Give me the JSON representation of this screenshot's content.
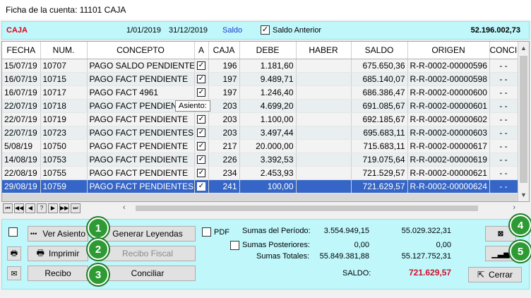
{
  "window": {
    "title": "Ficha de la cuenta: 11101 CAJA"
  },
  "header": {
    "account": "CAJA",
    "date_from": "1/01/2019",
    "date_to": "31/12/2019",
    "saldo_link": "Saldo",
    "saldo_anterior_label": "Saldo  Anterior",
    "saldo_anterior_checked": true,
    "total": "52.196.002,73"
  },
  "grid": {
    "columns": [
      "FECHA",
      "NUM.",
      "CONCEPTO",
      "A",
      "CAJA",
      "DEBE",
      "HABER",
      "SALDO",
      "ORIGEN",
      "CONCILIA"
    ],
    "rows": [
      {
        "fecha": "15/07/19",
        "num": "10707",
        "concepto": "PAGO SALDO PENDIENTE",
        "caja": "196",
        "debe": "1.181,60",
        "haber": "",
        "saldo": "675.650,36",
        "origen": "R-R-0002-00000596",
        "concilia": "- -"
      },
      {
        "fecha": "16/07/19",
        "num": "10715",
        "concepto": "PAGO FACT PENDIENTE",
        "caja": "197",
        "debe": "9.489,71",
        "haber": "",
        "saldo": "685.140,07",
        "origen": "R-R-0002-00000598",
        "concilia": "- -"
      },
      {
        "fecha": "16/07/19",
        "num": "10717",
        "concepto": "PAGO FACT 4961",
        "caja": "197",
        "debe": "1.246,40",
        "haber": "",
        "saldo": "686.386,47",
        "origen": "R-R-0002-00000600",
        "concilia": "- -"
      },
      {
        "fecha": "22/07/19",
        "num": "10718",
        "concepto": "PAGO FACT PENDIEN",
        "caja": "203",
        "debe": "4.699,20",
        "haber": "",
        "saldo": "691.085,67",
        "origen": "R-R-0002-00000601",
        "concilia": "- -"
      },
      {
        "fecha": "22/07/19",
        "num": "10719",
        "concepto": "PAGO FACT PENDIENTE",
        "caja": "203",
        "debe": "1.100,00",
        "haber": "",
        "saldo": "692.185,67",
        "origen": "R-R-0002-00000602",
        "concilia": "- -"
      },
      {
        "fecha": "22/07/19",
        "num": "10723",
        "concepto": "PAGO FACT PENDIENTES",
        "caja": "203",
        "debe": "3.497,44",
        "haber": "",
        "saldo": "695.683,11",
        "origen": "R-R-0002-00000603",
        "concilia": "- -"
      },
      {
        "fecha": "5/08/19",
        "num": "10750",
        "concepto": "PAGO FACT PENDIENTE",
        "caja": "217",
        "debe": "20.000,00",
        "haber": "",
        "saldo": "715.683,11",
        "origen": "R-R-0002-00000617",
        "concilia": "- -"
      },
      {
        "fecha": "14/08/19",
        "num": "10753",
        "concepto": "PAGO FACT PENDIENTE",
        "caja": "226",
        "debe": "3.392,53",
        "haber": "",
        "saldo": "719.075,64",
        "origen": "R-R-0002-00000619",
        "concilia": "- -"
      },
      {
        "fecha": "22/08/19",
        "num": "10755",
        "concepto": "PAGO FACT PENDIENTE",
        "caja": "234",
        "debe": "2.453,93",
        "haber": "",
        "saldo": "721.529,57",
        "origen": "R-R-0002-00000621",
        "concilia": "- -"
      },
      {
        "fecha": "29/08/19",
        "num": "10759",
        "concepto": "PAGO FACT PENDIENTES",
        "caja": "241",
        "debe": "100,00",
        "haber": "",
        "saldo": "721.629,57",
        "origen": "R-R-0002-00000624",
        "concilia": "- -"
      }
    ],
    "selected_row_index": 9,
    "tooltip": "Asiento:"
  },
  "navigator": [
    "⏮",
    "◀◀",
    "◀",
    "?",
    "▶",
    "▶▶",
    "⏭"
  ],
  "buttons": {
    "ver_asiento": "Ver Asiento",
    "ver_asiento_prefix": "•••",
    "generar_leyendas": "Generar Leyendas",
    "imprimir": "Imprimir",
    "recibo_fiscal": "Recibo Fiscal",
    "recibo": "Recibo",
    "conciliar": "Conciliar",
    "cerrar": "Cerrar"
  },
  "totals": {
    "pdf_label": "PDF",
    "sumas_periodo_label": "Sumas del Período:",
    "sumas_periodo_debe": "3.554.949,15",
    "sumas_periodo_haber": "55.029.322,31",
    "sumas_posteriores_label": "Sumas Posteriores:",
    "sumas_posteriores_debe": "0,00",
    "sumas_posteriores_haber": "0,00",
    "sumas_totales_label": "Sumas Totales:",
    "sumas_totales_debe": "55.849.381,88",
    "sumas_totales_haber": "55.127.752,31",
    "saldo_label": "SALDO:",
    "saldo_value": "721.629,57"
  },
  "callouts": [
    "1",
    "2",
    "3",
    "4",
    "5"
  ],
  "colors": {
    "accent_cyan": "#bff7fb",
    "selected_row": "#3565c6",
    "callout_green": "#2e9a33",
    "red_text": "#d0102a"
  }
}
